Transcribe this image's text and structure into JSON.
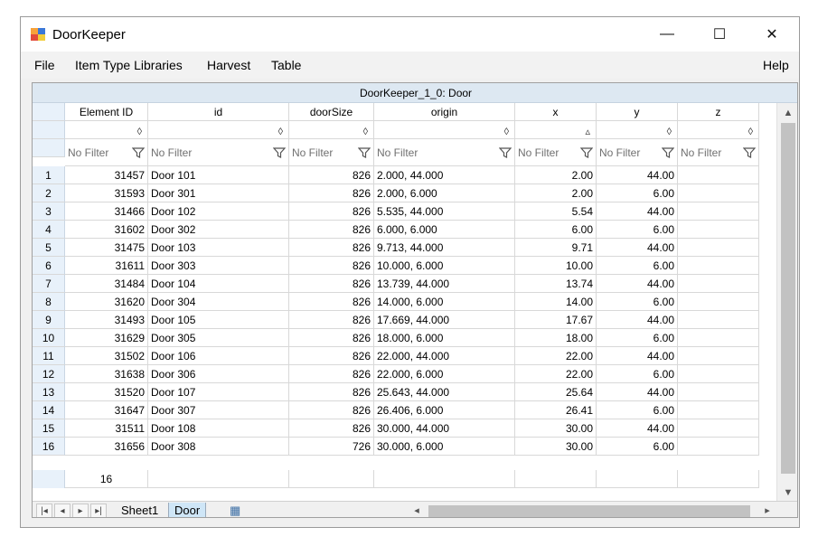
{
  "window": {
    "title": "DoorKeeper",
    "minimize_glyph": "—",
    "maximize_glyph": "☐",
    "close_glyph": "✕"
  },
  "menu": {
    "file": "File",
    "item_type_libraries": "Item Type Libraries",
    "harvest": "Harvest",
    "table": "Table",
    "help": "Help"
  },
  "grid": {
    "title": "DoorKeeper_1_0: Door",
    "columns": [
      "Element ID",
      "id",
      "doorSize",
      "origin",
      "x",
      "y",
      "z"
    ],
    "sort_indicators": [
      "◊",
      "◊",
      "◊",
      "◊",
      "▵",
      "◊",
      "◊"
    ],
    "filter_placeholder": "No Filter",
    "rows": [
      [
        "1",
        "31457",
        "Door 101",
        "826",
        "2.000, 44.000",
        "2.00",
        "44.00",
        ""
      ],
      [
        "2",
        "31593",
        "Door 301",
        "826",
        "2.000, 6.000",
        "2.00",
        "6.00",
        ""
      ],
      [
        "3",
        "31466",
        "Door 102",
        "826",
        "5.535, 44.000",
        "5.54",
        "44.00",
        ""
      ],
      [
        "4",
        "31602",
        "Door 302",
        "826",
        "6.000, 6.000",
        "6.00",
        "6.00",
        ""
      ],
      [
        "5",
        "31475",
        "Door 103",
        "826",
        "9.713, 44.000",
        "9.71",
        "44.00",
        ""
      ],
      [
        "6",
        "31611",
        "Door 303",
        "826",
        "10.000, 6.000",
        "10.00",
        "6.00",
        ""
      ],
      [
        "7",
        "31484",
        "Door 104",
        "826",
        "13.739, 44.000",
        "13.74",
        "44.00",
        ""
      ],
      [
        "8",
        "31620",
        "Door 304",
        "826",
        "14.000, 6.000",
        "14.00",
        "6.00",
        ""
      ],
      [
        "9",
        "31493",
        "Door 105",
        "826",
        "17.669, 44.000",
        "17.67",
        "44.00",
        ""
      ],
      [
        "10",
        "31629",
        "Door 305",
        "826",
        "18.000, 6.000",
        "18.00",
        "6.00",
        ""
      ],
      [
        "11",
        "31502",
        "Door 106",
        "826",
        "22.000, 44.000",
        "22.00",
        "44.00",
        ""
      ],
      [
        "12",
        "31638",
        "Door 306",
        "826",
        "22.000, 6.000",
        "22.00",
        "6.00",
        ""
      ],
      [
        "13",
        "31520",
        "Door 107",
        "826",
        "25.643, 44.000",
        "25.64",
        "44.00",
        ""
      ],
      [
        "14",
        "31647",
        "Door 307",
        "826",
        "26.406, 6.000",
        "26.41",
        "6.00",
        ""
      ],
      [
        "15",
        "31511",
        "Door 108",
        "826",
        "30.000, 44.000",
        "30.00",
        "44.00",
        ""
      ],
      [
        "16",
        "31656",
        "Door 308",
        "726",
        "30.000, 6.000",
        "30.00",
        "6.00",
        ""
      ]
    ],
    "footer_count": "16"
  },
  "sheets": {
    "tabs": [
      "Sheet1",
      "Door"
    ],
    "active": "Door"
  },
  "icons": {
    "app": "doorkeeper-app-icon",
    "funnel": "filter-funnel-icon",
    "sort": "sort-diamond-icon",
    "nav_first": "first-sheet-icon",
    "nav_prev": "prev-sheet-icon",
    "nav_next": "next-sheet-icon",
    "nav_last": "last-sheet-icon",
    "new_sheet": "new-sheet-icon"
  },
  "colors": {
    "row_header_bg": "#e8f1fa",
    "title_bar_bg": "#dde8f2",
    "active_tab_bg": "#cfe6f7"
  }
}
